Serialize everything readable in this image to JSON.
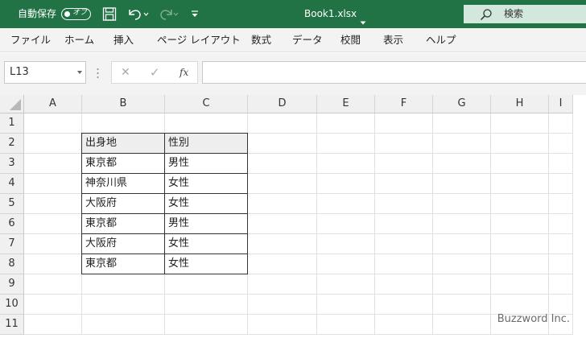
{
  "title_bar": {
    "autosave_label": "自動保存",
    "autosave_state": "オフ",
    "document_title": "Book1.xlsx",
    "search_placeholder": "検索",
    "icons": [
      "save-icon",
      "undo-icon",
      "redo-icon",
      "customize-quick-access-icon",
      "search-icon"
    ]
  },
  "ribbon_tabs": [
    "ファイル",
    "ホーム",
    "挿入",
    "ページ レイアウト",
    "数式",
    "データ",
    "校閲",
    "表示",
    "ヘルプ"
  ],
  "formula_bar": {
    "name_box": "L13",
    "formula": "",
    "cancel_symbol": "✕",
    "enter_symbol": "✓",
    "fx_symbol": "fx"
  },
  "sheet": {
    "columns": [
      "A",
      "B",
      "C",
      "D",
      "E",
      "F",
      "G",
      "H",
      "I"
    ],
    "rows": [
      "1",
      "2",
      "3",
      "4",
      "5",
      "6",
      "7",
      "8",
      "9",
      "10",
      "11"
    ],
    "table": {
      "header": [
        "出身地",
        "性別"
      ],
      "rows": [
        [
          "東京都",
          "男性"
        ],
        [
          "神奈川県",
          "女性"
        ],
        [
          "大阪府",
          "女性"
        ],
        [
          "東京都",
          "男性"
        ],
        [
          "大阪府",
          "女性"
        ],
        [
          "東京都",
          "女性"
        ]
      ]
    }
  },
  "watermark": "Buzzword Inc.",
  "colors": {
    "title_bar": "#217346",
    "search_box": "#d3e8dc",
    "header_bg": "#f0f0f0",
    "table_header_bg": "#eeeeee"
  }
}
